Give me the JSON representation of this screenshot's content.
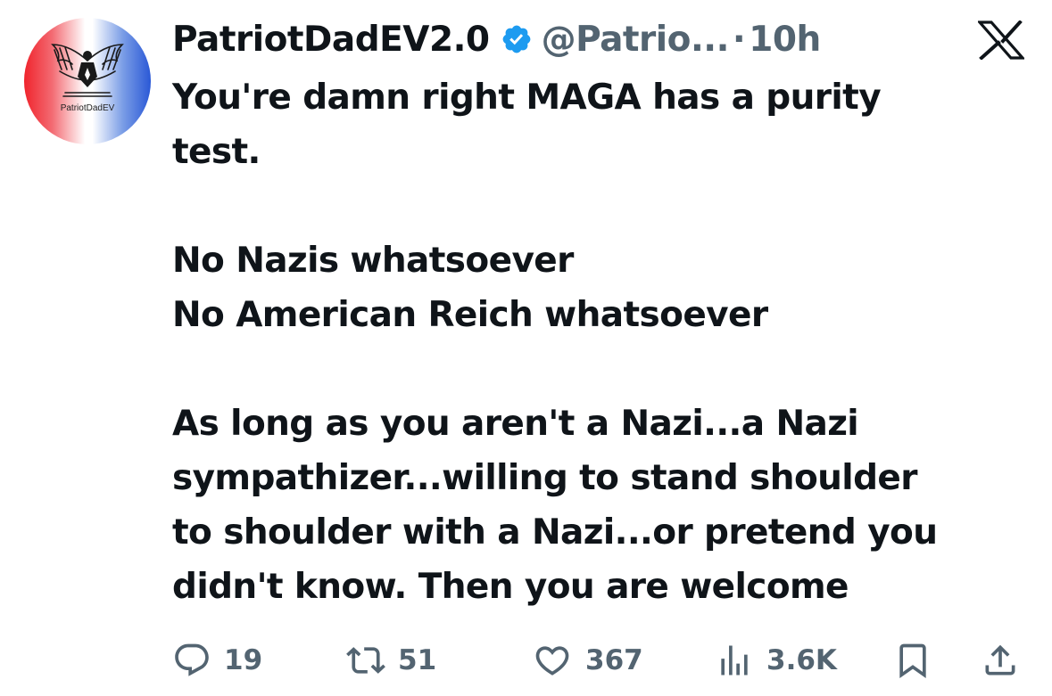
{
  "author": {
    "display_name": "PatriotDadEV2.0",
    "handle": "@Patrio...",
    "separator": "·",
    "time": "10h",
    "avatar_label": "PatriotDadEV",
    "verified_color": "#1d9bf0"
  },
  "tweet": {
    "paragraph1": [
      "You're damn right MAGA has a purity",
      "test."
    ],
    "paragraph2": [
      "No Nazis whatsoever",
      "No American Reich whatsoever"
    ],
    "paragraph3": [
      "As long as you aren't a Nazi...a Nazi",
      "sympathizer...willing to stand shoulder",
      "to shoulder with a Nazi...or pretend you",
      "didn't know. Then you are welcome"
    ]
  },
  "actions": {
    "replies": "19",
    "reposts": "51",
    "likes": "367",
    "views": "3.6K"
  },
  "icons": {
    "logo": "x-logo-icon",
    "reply": "reply-icon",
    "repost": "repost-icon",
    "like": "heart-icon",
    "views": "views-icon",
    "bookmark": "bookmark-icon",
    "share": "share-icon"
  },
  "colors": {
    "text": "#0f1419",
    "muted": "#536471",
    "verified": "#1d9bf0"
  }
}
